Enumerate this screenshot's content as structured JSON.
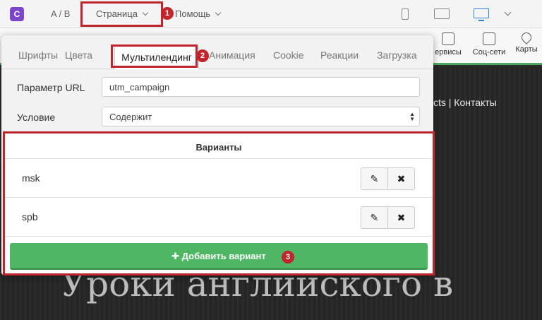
{
  "topbar": {
    "logo_letter": "C",
    "ab_label": "A / B",
    "page_menu": "Страница",
    "help_menu": "Помощь"
  },
  "toolbar": {
    "services": "ервисы",
    "social": "Соц-сети",
    "maps": "Карты"
  },
  "page": {
    "nav_links": "cts | Контакты",
    "hero_text": "Уроки английского в"
  },
  "tabs": [
    "Шрифты",
    "Цвета",
    "Мультилендинг",
    "Анимация",
    "Cookie",
    "Реакции",
    "Загрузка"
  ],
  "form": {
    "url_param_label": "Параметр URL",
    "url_param_value": "utm_campaign",
    "condition_label": "Условие",
    "condition_value": "Содержит"
  },
  "variants": {
    "header": "Варианты",
    "rows": [
      {
        "name": "msk"
      },
      {
        "name": "spb"
      }
    ],
    "edit_icon": "pencil-icon",
    "delete_icon": "x-icon",
    "add_label": "Добавить вариант"
  },
  "badges": [
    "1",
    "2",
    "3"
  ],
  "colors": {
    "accent_red": "#c0252b",
    "green": "#4fb763",
    "logo_purple": "#7a45c8",
    "desktop_blue": "#2f7fd6"
  }
}
